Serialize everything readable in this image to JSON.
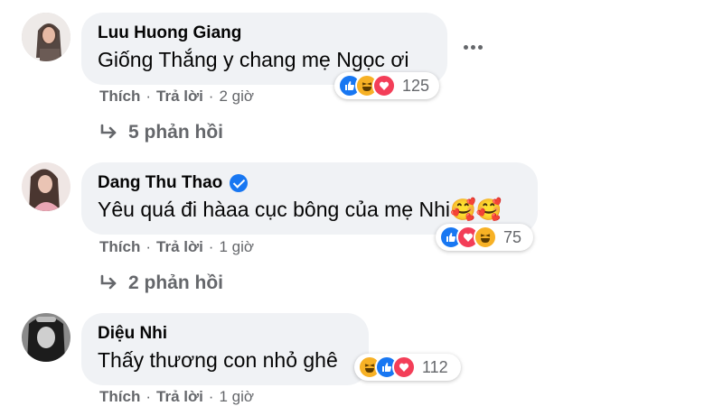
{
  "comments": [
    {
      "author": "Luu Huong Giang",
      "text": "Giống Thắng y chang mẹ Ngọc ơi",
      "like_label": "Thích",
      "reply_label": "Trả lời",
      "time": "2 giờ",
      "reaction_count": "125",
      "reactions": [
        "like-icon",
        "haha-icon",
        "love-icon"
      ],
      "replies_label": "5 phản hồi"
    },
    {
      "author": "Dang Thu Thao",
      "verified": true,
      "text": "Yêu quá đi hàaa cục bông của mẹ Nhi🥰🥰",
      "like_label": "Thích",
      "reply_label": "Trả lời",
      "time": "1 giờ",
      "reaction_count": "75",
      "reactions": [
        "like-icon",
        "love-icon",
        "haha-icon"
      ],
      "replies_label": "2 phản hồi"
    },
    {
      "author": "Diệu Nhi",
      "text": "Thấy thương con nhỏ ghê",
      "like_label": "Thích",
      "reply_label": "Trả lời",
      "time": "1 giờ",
      "reaction_count": "112",
      "reactions": [
        "haha-icon",
        "like-icon",
        "love-icon"
      ]
    }
  ],
  "colors": {
    "bubble": "#f0f2f5",
    "meta_text": "#65676b",
    "like": "#1877f2",
    "love": "#f33e58",
    "haha": "#f7b125"
  }
}
